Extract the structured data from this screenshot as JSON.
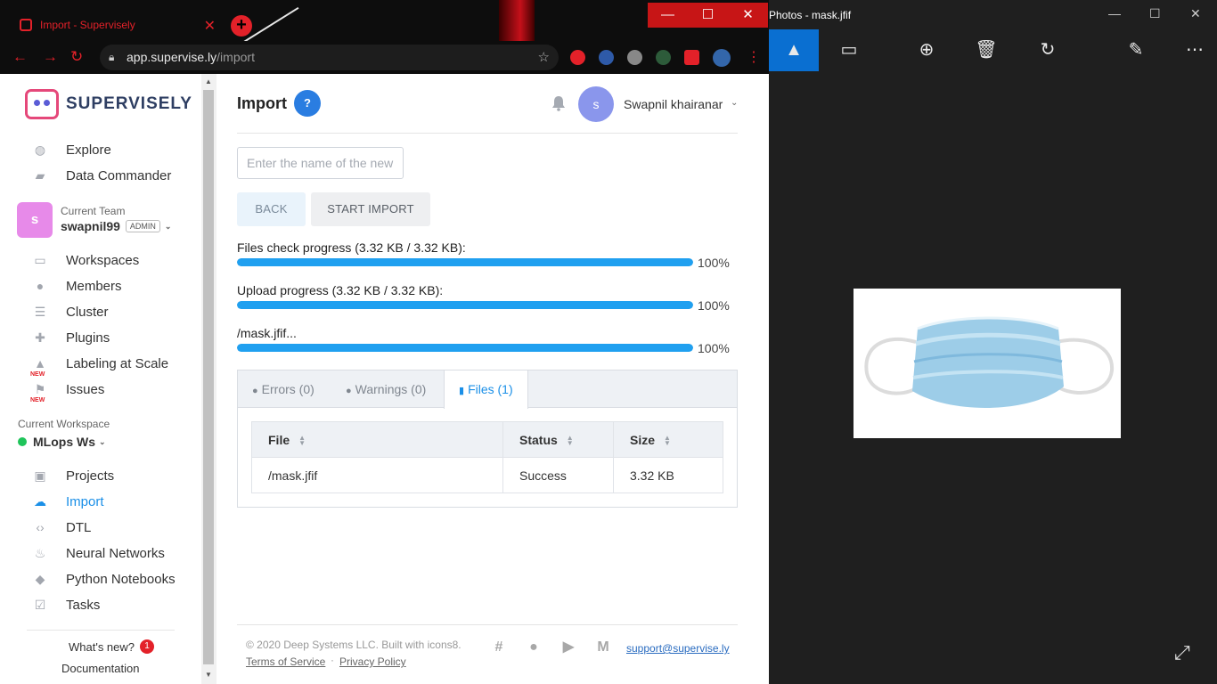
{
  "browser": {
    "tab_title": "Import - Supervisely",
    "url_host": "app.supervise.ly",
    "url_path": "/import"
  },
  "sidebar": {
    "logo_text": "SUPERVISELY",
    "top_items": [
      {
        "label": "Explore",
        "icon": "globe-icon"
      },
      {
        "label": "Data Commander",
        "icon": "folder-icon"
      }
    ],
    "team": {
      "caption": "Current Team",
      "name": "swapnil99",
      "role": "ADMIN",
      "avatar": "s",
      "avatar_color": "#e78ae9"
    },
    "team_items": [
      {
        "label": "Workspaces",
        "icon": "monitor-icon"
      },
      {
        "label": "Members",
        "icon": "members-icon"
      },
      {
        "label": "Cluster",
        "icon": "cluster-icon"
      },
      {
        "label": "Plugins",
        "icon": "puzzle-icon"
      },
      {
        "label": "Labeling at Scale",
        "icon": "graduation-cap-icon",
        "badge": "NEW"
      },
      {
        "label": "Issues",
        "icon": "flag-icon",
        "badge": "NEW"
      }
    ],
    "workspace": {
      "caption": "Current Workspace",
      "name": "MLops Ws",
      "status_color": "#1fc45a"
    },
    "ws_items": [
      {
        "label": "Projects",
        "icon": "images-icon"
      },
      {
        "label": "Import",
        "icon": "cloud-upload-icon",
        "active": true
      },
      {
        "label": "DTL",
        "icon": "code-icon"
      },
      {
        "label": "Neural Networks",
        "icon": "flame-icon"
      },
      {
        "label": "Python Notebooks",
        "icon": "python-icon"
      },
      {
        "label": "Tasks",
        "icon": "checkbox-icon"
      }
    ],
    "whats_new": "What's new?",
    "whats_new_count": "1",
    "documentation": "Documentation"
  },
  "header": {
    "title": "Import",
    "help": "?",
    "user_avatar": "s",
    "user_name": "Swapnil khairanar"
  },
  "form": {
    "name_placeholder": "Enter the name of the new",
    "back_label": "BACK",
    "start_label": "START IMPORT"
  },
  "progress": [
    {
      "label": "Files check progress (3.32 KB / 3.32 KB):",
      "percent_text": "100%",
      "fraction": 1.0
    },
    {
      "label": "Upload progress (3.32 KB / 3.32 KB):",
      "percent_text": "100%",
      "fraction": 1.0
    },
    {
      "label": "/mask.jfif...",
      "percent_text": "100%",
      "fraction": 1.0
    }
  ],
  "tabs": [
    {
      "label": "Errors (0)",
      "icon": "error-icon"
    },
    {
      "label": "Warnings (0)",
      "icon": "warning-icon"
    },
    {
      "label": "Files (1)",
      "icon": "file-icon",
      "selected": true
    }
  ],
  "files_table": {
    "columns": [
      "File",
      "Status",
      "Size"
    ],
    "rows": [
      [
        "/mask.jfif",
        "Success",
        "3.32 KB"
      ]
    ]
  },
  "footer": {
    "copyright": "© 2020 Deep Systems LLC. Built with icons8.",
    "terms": "Terms of Service",
    "privacy": "Privacy Policy",
    "separator": "·",
    "support": "support@supervise.ly"
  },
  "photos_app": {
    "title": "Photos - mask.jfif"
  },
  "colors": {
    "accent": "#1a8fe7",
    "progress": "#20a0f0",
    "browser_accent": "#e32129",
    "photos_selected": "#0a6fd1"
  }
}
